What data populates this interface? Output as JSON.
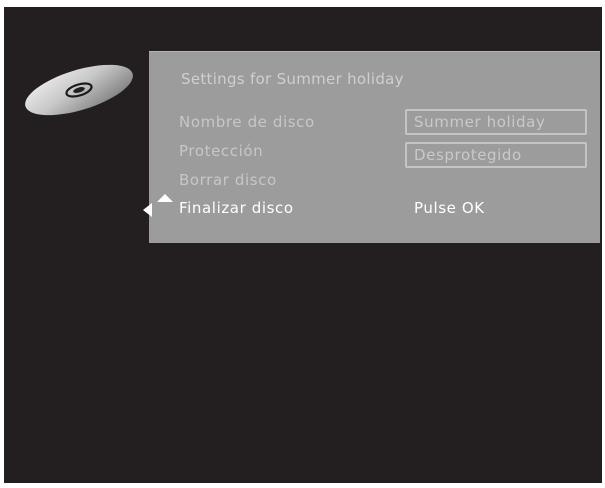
{
  "menu": {
    "title": "Settings for Summer holiday",
    "rows": [
      {
        "label": "Nombre de disco",
        "value": "Summer holiday"
      },
      {
        "label": "Protección",
        "value": "Desprotegido"
      },
      {
        "label": "Borrar disco"
      },
      {
        "label": "Finalizar disco",
        "action": "Pulse OK"
      }
    ],
    "selected_index": 3
  },
  "icons": {
    "disc": "disc-icon",
    "nav_left": "arrow-left-icon",
    "nav_up": "arrow-up-icon"
  },
  "colors": {
    "screen_background": "#231f20",
    "panel_background": "#9d9c9c",
    "inactive_text": "#c7c7c7",
    "active_text": "#ffffff"
  }
}
